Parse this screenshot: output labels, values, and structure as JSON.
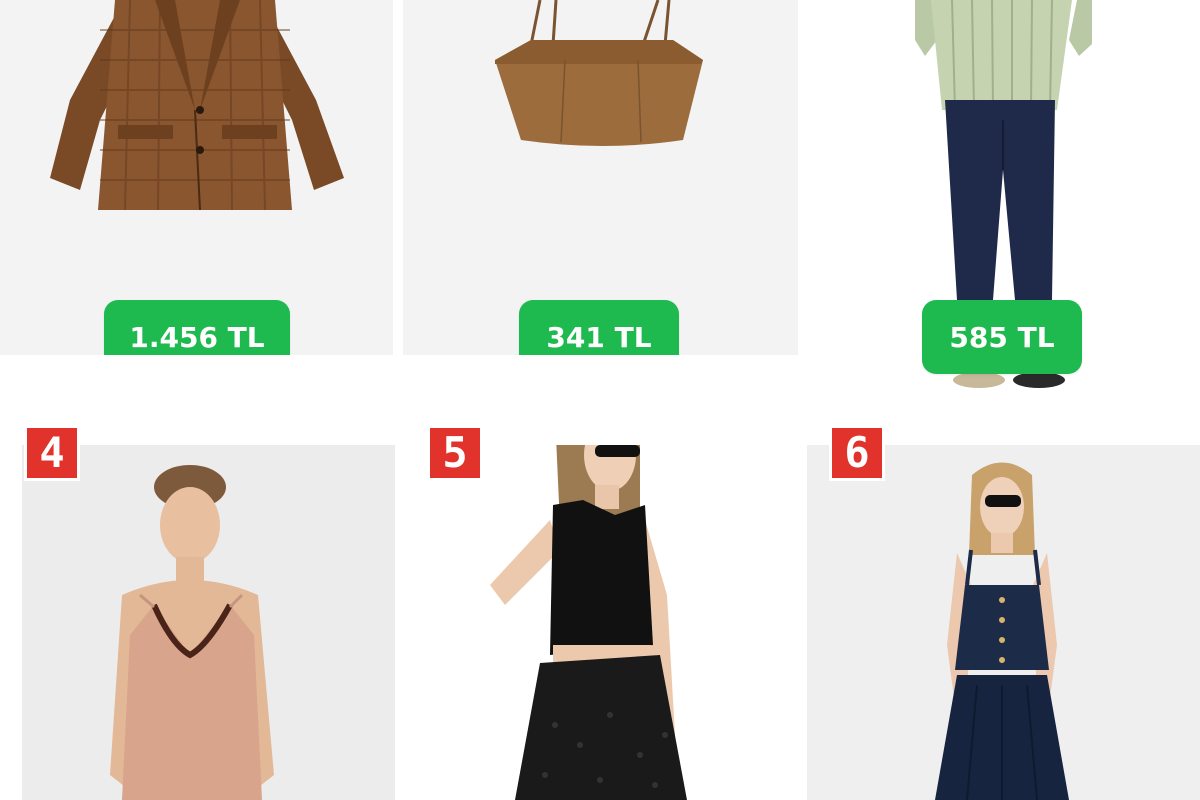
{
  "products": [
    {
      "price": "1.456 TL",
      "item": "brown check blazer"
    },
    {
      "price": "341 TL",
      "item": "tan bandeau crop top"
    },
    {
      "price": "585 TL",
      "item": "striped shirt and dark jeans"
    },
    {
      "number": "4",
      "item": "nude lace trim camisole"
    },
    {
      "number": "5",
      "item": "black tank with lace skirt"
    },
    {
      "number": "6",
      "item": "denim bustier and wide skirt"
    }
  ],
  "colors": {
    "price_badge": "#1fba4f",
    "number_badge": "#e1332b",
    "photo_background": "#f3f3f3"
  }
}
